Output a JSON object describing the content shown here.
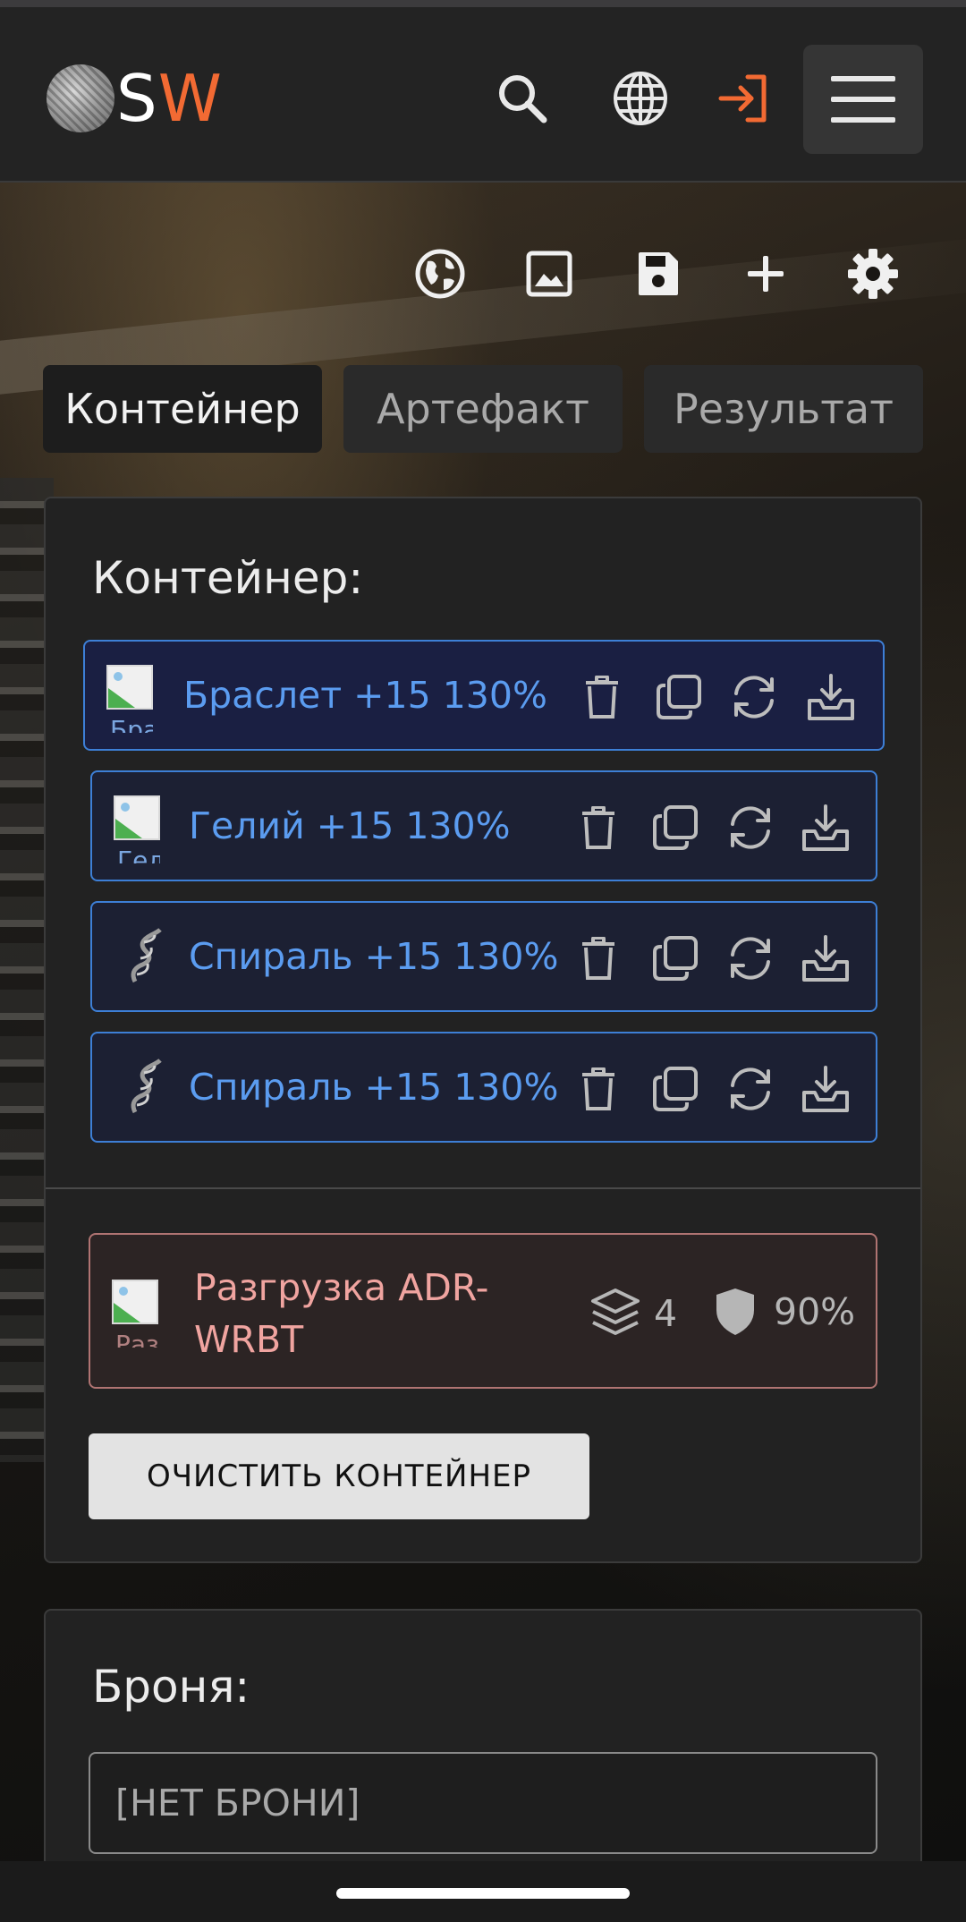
{
  "header": {
    "logo_s": "S",
    "logo_w": "W",
    "icons": [
      "search-icon",
      "globe-icon",
      "login-icon",
      "menu-icon"
    ],
    "accent": "#f26a33"
  },
  "toolbar": {
    "icons": [
      "world-map-icon",
      "image-icon",
      "save-icon",
      "plus-icon",
      "gear-icon"
    ]
  },
  "tabs": [
    {
      "label": "Контейнер",
      "active": true
    },
    {
      "label": "Артефакт",
      "active": false
    },
    {
      "label": "Результат",
      "active": false
    }
  ],
  "container": {
    "title": "Контейнер:",
    "items": [
      {
        "label": "Браслет +15 130%",
        "alt": "Бра",
        "image": "broken-image",
        "selected": true
      },
      {
        "label": "Гелий +15 130%",
        "alt": "Гел",
        "image": "broken-image",
        "selected": false
      },
      {
        "label": "Спираль +15 130%",
        "alt": "",
        "image": "spiral-icon",
        "selected": false
      },
      {
        "label": "Спираль +15 130%",
        "alt": "",
        "image": "spiral-icon",
        "selected": false
      }
    ],
    "item_actions": [
      "trash-icon",
      "copy-icon",
      "refresh-icon",
      "download-icon"
    ],
    "equipped": {
      "name": "Разгрузка ADR-WRBT",
      "alt": "Раз",
      "slots": "4",
      "protection": "90%"
    },
    "clear_button": "ОЧИСТИТЬ КОНТЕЙНЕР"
  },
  "armor": {
    "title": "Броня:",
    "value": "[НЕТ БРОНИ]"
  }
}
